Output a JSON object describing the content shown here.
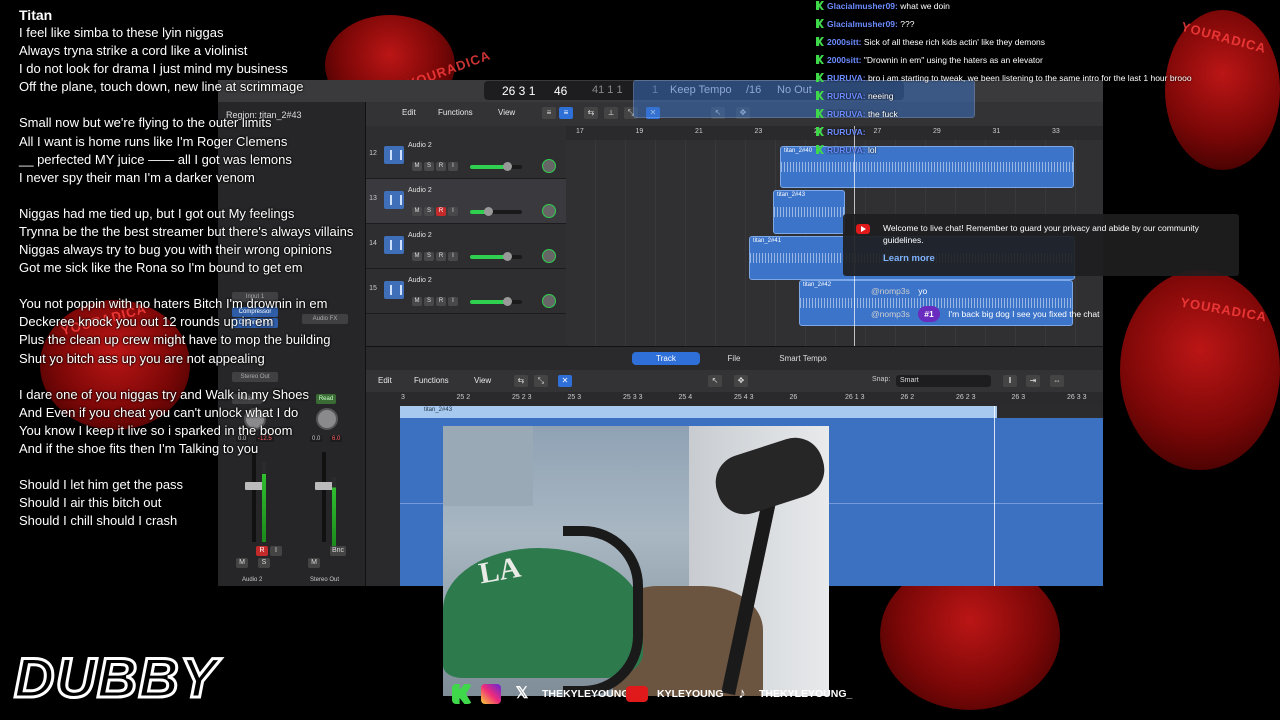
{
  "colors": {
    "accent": "#2f6fd8",
    "region": "#3c74c9",
    "chat_username": "#6b8bff",
    "kick_green": "#3fd84a",
    "record_red": "#c42a2a"
  },
  "background": {
    "words": [
      "YOURADICA",
      "YOURADICA",
      "YOURADICA",
      "YOURADICA"
    ]
  },
  "lyrics": {
    "title": "Titan",
    "lines": [
      "I feel like simba to these lyin niggas",
      "Always tryna strike a cord like a violinist",
      "I do not look for drama I just mind my business",
      "Off the plane, touch down, new line at scrimmage",
      "",
      "Small now but we're flying to the outer limits",
      "All I want is home runs like I'm Roger Clemens",
      "__ perfected MY juice —— all I got was lemons",
      "I never spy  their man I'm a darker venom",
      "",
      "Niggas had me tied up, but I got out My feelings",
      "Trynna be the the best streamer  but there's always villains",
      "Niggas always try to bug you with their wrong opinions",
      "Got me sick like the Rona so I'm bound to get em",
      "",
      "You not poppin with no haters Bitch I'm drownin in em",
      "Deckeree knock you out 12 rounds up in em",
      "Plus the clean up crew might have to mop the building",
      "Shut yo bitch ass up you are not appealing",
      "",
      "I dare one of you niggas try and Walk in my Shoes",
      "And Even if you cheat you can't unlock what I do",
      "You know I keep it live so i sparked in the boom",
      "And if the shoe fits  then I'm Talking to you",
      "",
      "Should I let him get the pass",
      "Should I air this bitch out",
      "Should I chill should I crash"
    ]
  },
  "daw": {
    "lcd": {
      "position": "26  3  1",
      "subdiv": "46",
      "locator": "41  1  1",
      "locator_end": "1",
      "tempo_mode": "Keep Tempo",
      "signature": "/16",
      "output": "No Out"
    },
    "inspector": {
      "region_label": "Region: titan_2#43",
      "plugins": [
        "Compressor",
        "Channel EQ"
      ],
      "input": "Input 1",
      "audio_fx": "Audio FX",
      "stereo_out": "Stereo Out",
      "read_left": "Read",
      "read_right": "Read",
      "left_vol": "0.0",
      "left_peak": "-12.5",
      "right_vol": "0.0",
      "right_peak": "6.0",
      "left_name": "Audio 2",
      "right_name": "Stereo Out",
      "bnc": "Bnc"
    },
    "toolbar": {
      "edit": "Edit",
      "functions": "Functions",
      "view": "View"
    },
    "ruler": [
      "17",
      "19",
      "21",
      "23",
      "25",
      "27",
      "29",
      "31",
      "33"
    ],
    "tracks": [
      {
        "num": "12",
        "name": "Audio 2",
        "vol": 0.72,
        "rec": false
      },
      {
        "num": "13",
        "name": "Audio 2",
        "vol": 0.35,
        "rec": true
      },
      {
        "num": "14",
        "name": "Audio 2",
        "vol": 0.72,
        "rec": false
      },
      {
        "num": "15",
        "name": "Audio 2",
        "vol": 0.72,
        "rec": false
      }
    ],
    "regions": [
      "titan_2#40",
      "titan_2#43",
      "titan_2#41",
      "titan_2#42"
    ],
    "tabs": {
      "track": "Track",
      "file": "File",
      "smart_tempo": "Smart Tempo"
    },
    "editor": {
      "edit": "Edit",
      "functions": "Functions",
      "view": "View",
      "snap_label": "Snap:",
      "snap_value": "Smart",
      "region_name": "titan_2#43",
      "ruler": [
        "3",
        "25 2",
        "25 2 3",
        "25 3",
        "25 3 3",
        "25 4",
        "25 4 3",
        "26",
        "26 1 3",
        "26 2",
        "26 2 3",
        "26 3",
        "26 3 3"
      ]
    }
  },
  "chat": {
    "messages": [
      {
        "user": "Glacialmusher09:",
        "text": "what we doin"
      },
      {
        "user": "Glacialmusher09:",
        "text": "???"
      },
      {
        "user": "2000sitt:",
        "text": "Sick of all these rich kids actin' like they demons"
      },
      {
        "user": "2000sitt:",
        "text": "\"Drownin in em\" using the haters as an elevator"
      },
      {
        "user": "RURUVA:",
        "text": "bro i am starting to tweak, we been listening to the same intro for the last 1 hour brooo"
      },
      {
        "user": "RURUVA:",
        "text": "neeing"
      },
      {
        "user": "RURUVA:",
        "text": "the fuck"
      },
      {
        "user": "RURUVA:",
        "text": ""
      },
      {
        "user": "RURUVA:",
        "text": "lol"
      }
    ],
    "notice": {
      "message": "Welcome to live chat! Remember to guard your privacy and abide by our community guidelines.",
      "link": "Learn more"
    },
    "plain": {
      "user": "@nomp3s",
      "text": "yo"
    },
    "pill": {
      "user": "@nomp3s",
      "rank": "#1",
      "text": "I'm back big dog I see you fixed the chat"
    }
  },
  "socials": {
    "x": "THEKYLEYOUNG",
    "youtube": "KYLEYOUNG",
    "tiktok": "THEKYLEYOUNG_"
  },
  "logo": "DUBBY"
}
